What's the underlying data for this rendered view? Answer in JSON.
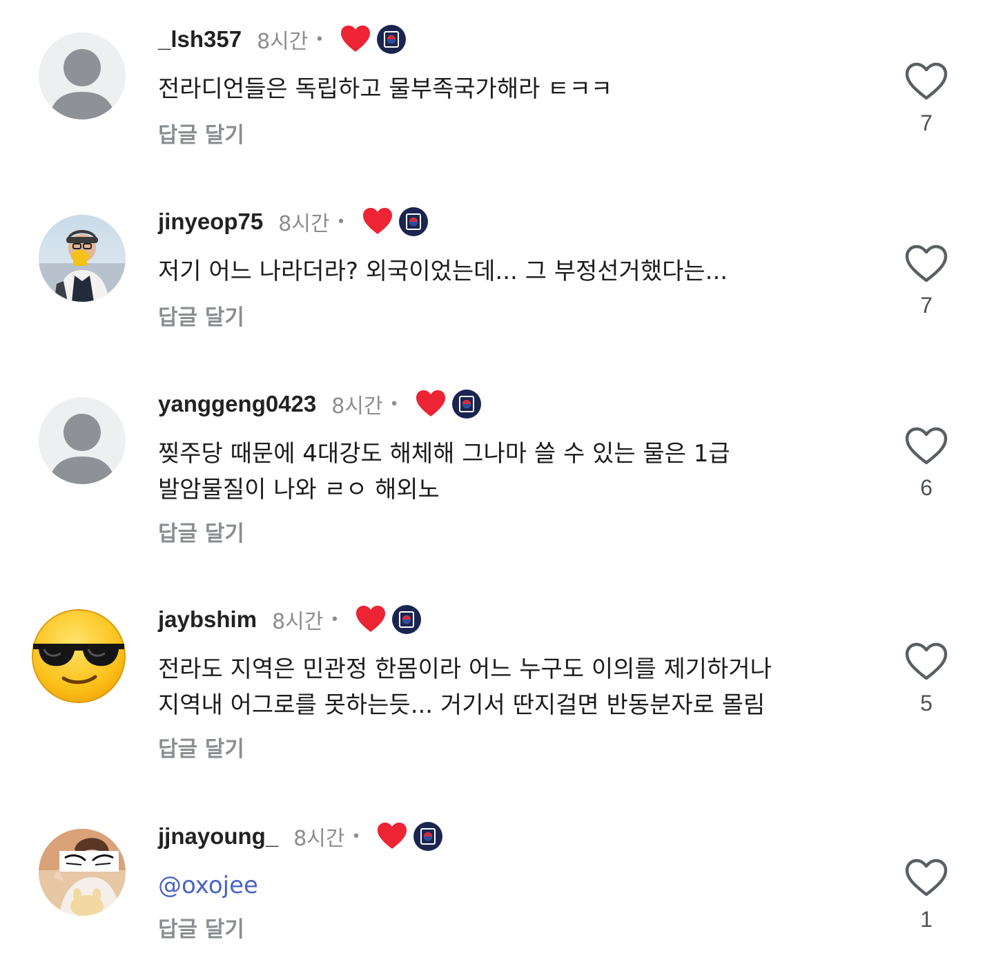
{
  "comments": [
    {
      "username": "_lsh357",
      "time": "8시간",
      "dot": "•",
      "text": "전라디언들은 독립하고 물부족국가해라 ㅌㅋㅋ",
      "reply_label": "답글 달기",
      "likes": "7",
      "avatar": "default-avatar"
    },
    {
      "username": "jinyeop75",
      "time": "8시간",
      "dot": "•",
      "text": "저기 어느 나라더라? 외국이었는데... 그 부정선거했다는...",
      "reply_label": "답글 달기",
      "likes": "7",
      "avatar": "photo-man-drinking-coffee"
    },
    {
      "username": "yanggeng0423",
      "time": "8시간",
      "dot": "•",
      "text": "찢주당 때문에 4대강도 해체해 그나마 쓸 수 있는 물은 1급\n발암물질이 나와 ㄹㅇ 해외노",
      "reply_label": "답글 달기",
      "likes": "6",
      "avatar": "default-avatar"
    },
    {
      "username": "jaybshim",
      "time": "8시간",
      "dot": "•",
      "text": "전라도 지역은 민관정 한몸이라 어느 누구도 이의를 제기하거나\n지역내 어그로를 못하는듯... 거기서 딴지걸면 반동분자로 몰림",
      "reply_label": "답글 달기",
      "likes": "5",
      "avatar": "sunglasses-emoji"
    },
    {
      "username": "jjnayoung_",
      "time": "8시간",
      "dot": "•",
      "mention": "@oxojee",
      "reply_label": "답글 달기",
      "likes": "1",
      "avatar": "photo-woman-with-plush"
    }
  ],
  "colors": {
    "heart_red": "#ec2433",
    "badge_navy": "#1b2550",
    "mention": "#4a63c8",
    "muted": "#8a8d91"
  }
}
